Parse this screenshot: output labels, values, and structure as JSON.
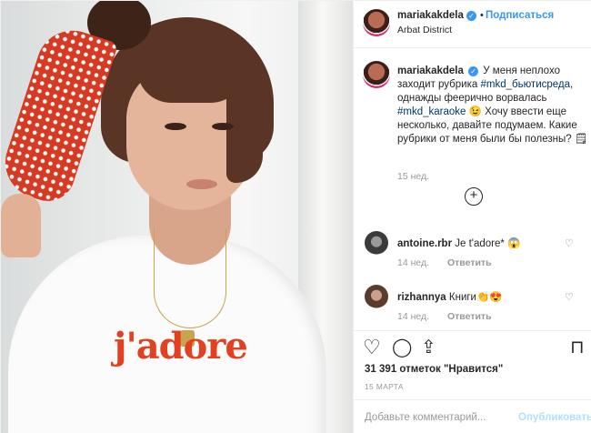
{
  "header": {
    "username": "mariakakdela",
    "verified_glyph": "✓",
    "separator": "•",
    "follow_label": "Подписаться",
    "location": "Arbat District"
  },
  "caption": {
    "username": "mariakakdela",
    "text_1": "У меня неплохо заходит рубрика ",
    "hashtag_1": "#mkd_бьютисреда",
    "text_2": ", однажды феерично ворвалась ",
    "hashtag_2": "#mkd_karaoke",
    "text_3": " 😉 Хочу ввести еще несколько, давайте подумаем. Какие рубрики от меня были бы полезны? 🗒",
    "time": "15 нед."
  },
  "load_more_icon": "plus-circle-icon",
  "load_more_glyph": "+",
  "comments": [
    {
      "username": "antoine.rbr",
      "text": "Je t'adore* 😱",
      "time": "14 нед.",
      "reply": "Ответить",
      "like_glyph": "♡"
    },
    {
      "username": "rizhannya",
      "text": "Книги👏😍",
      "time": "14 нед.",
      "reply": "Ответить",
      "like_glyph": "♡"
    }
  ],
  "actions": {
    "like_glyph": "♡",
    "comment_glyph": "◯",
    "share_glyph": "⇪",
    "save_glyph": "⊓"
  },
  "likes": "31 391 отметок \"Нравится\"",
  "date": "15 МАРТА",
  "add_comment": {
    "placeholder": "Добавьте комментарий...",
    "publish_label": "Опубликовать"
  },
  "photo": {
    "shirt_print": "j'adore"
  },
  "colors": {
    "accent": "#3897f0",
    "hashtag": "#003569",
    "muted": "#999999",
    "publish_disabled": "#b2dffc"
  }
}
